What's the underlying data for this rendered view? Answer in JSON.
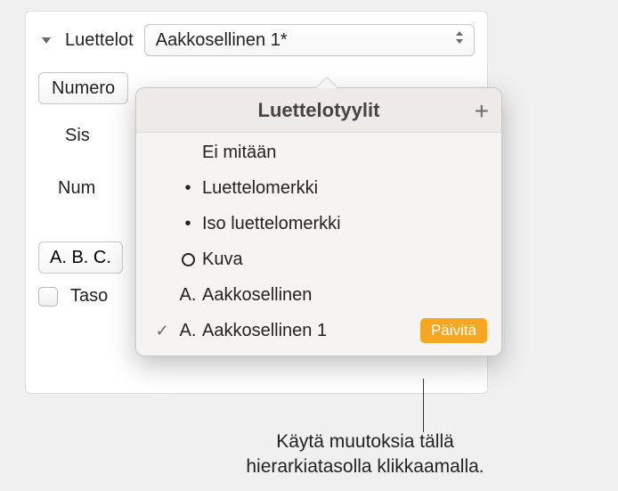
{
  "sidebar_label": "Luettelot",
  "dropdown_value": "Aakkosellinen 1*",
  "bullets_btn": "Numero",
  "indent_label": "Sis",
  "number_label": "Num",
  "format_value": "A. B. C.",
  "level_label": "Taso",
  "popover": {
    "title": "Luettelotyylit",
    "items": [
      {
        "bullet": "",
        "label": "Ei mitään"
      },
      {
        "bullet": "•",
        "label": "Luettelomerkki"
      },
      {
        "bullet": "•",
        "label": "Iso luettelomerkki"
      },
      {
        "bullet": "img",
        "label": "Kuva"
      },
      {
        "bullet": "A.",
        "label": "Aakkosellinen"
      },
      {
        "bullet": "A.",
        "label": "Aakkosellinen 1",
        "selected": true,
        "update": "Päivitä"
      }
    ]
  },
  "callout": {
    "line1": "Käytä muutoksia tällä",
    "line2": "hierarkiatasolla klikkaamalla."
  }
}
